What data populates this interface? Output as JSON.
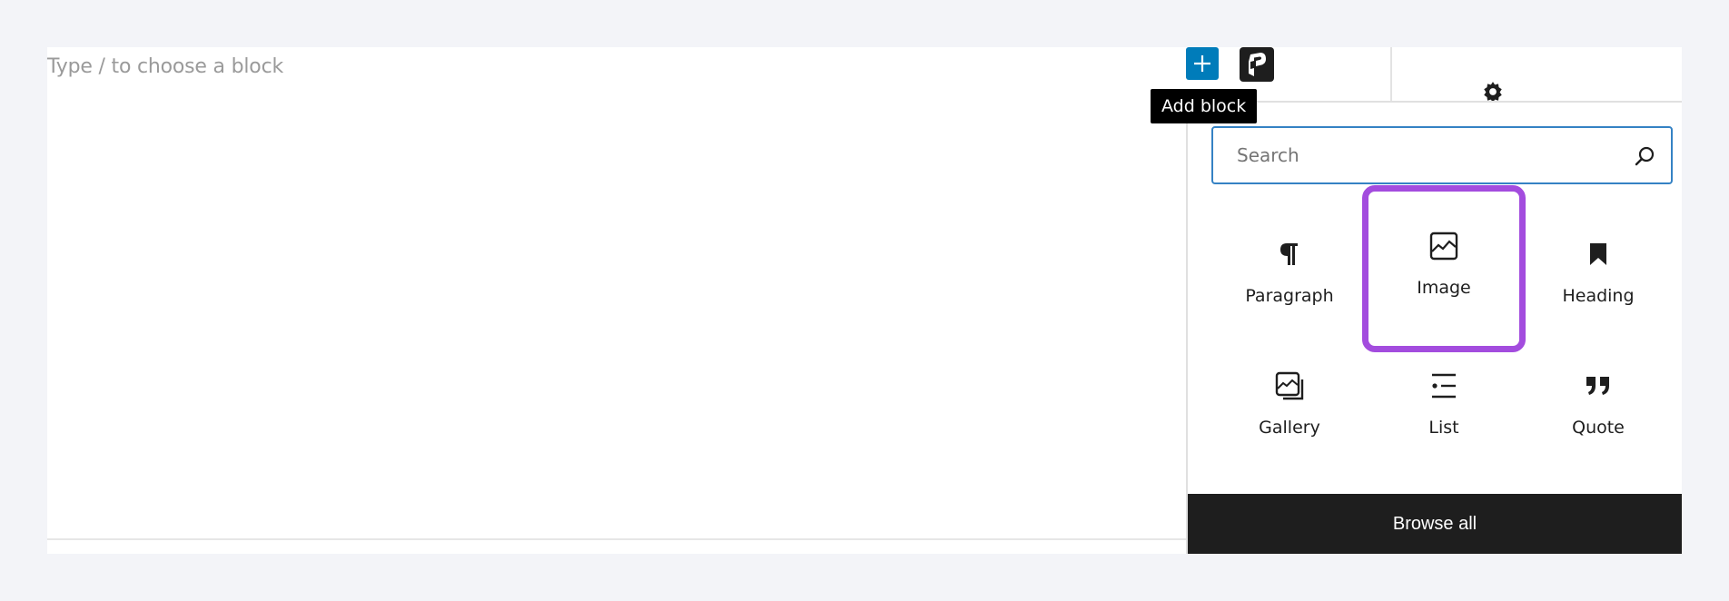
{
  "editor": {
    "placeholder": "Type / to choose a block"
  },
  "toolbar": {
    "add_block_icon": "plus-icon",
    "logo_icon": "brand-logo-icon",
    "settings_icon": "gear-icon",
    "tooltip": "Add block"
  },
  "inserter": {
    "search_placeholder": "Search",
    "search_value": "",
    "search_icon": "search-icon",
    "blocks": [
      {
        "label": "Paragraph",
        "icon": "paragraph-icon",
        "highlighted": false
      },
      {
        "label": "Image",
        "icon": "image-icon",
        "highlighted": true
      },
      {
        "label": "Heading",
        "icon": "bookmark-icon",
        "highlighted": false
      },
      {
        "label": "Gallery",
        "icon": "gallery-icon",
        "highlighted": false
      },
      {
        "label": "List",
        "icon": "list-icon",
        "highlighted": false
      },
      {
        "label": "Quote",
        "icon": "quote-icon",
        "highlighted": false
      }
    ],
    "browse_all_label": "Browse all"
  },
  "colors": {
    "accent": "#007cba",
    "highlight": "#a34cde",
    "dark": "#1e1e1e",
    "background": "#f3f4f8"
  }
}
